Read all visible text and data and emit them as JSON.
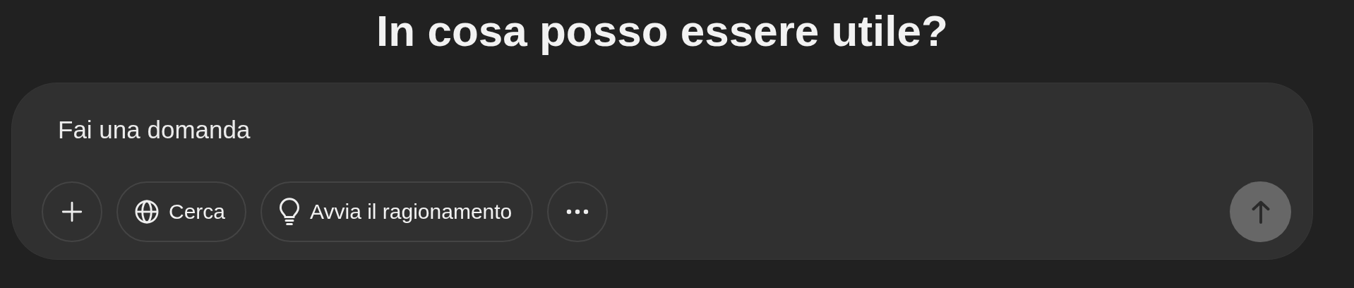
{
  "heading": "In cosa posso essere utile?",
  "composer": {
    "placeholder": "Fai una domanda",
    "tools": [
      {
        "kind": "plus"
      },
      {
        "kind": "globe",
        "label": "Cerca"
      },
      {
        "kind": "bulb",
        "label": "Avvia il ragionamento"
      },
      {
        "kind": "more"
      }
    ],
    "send": {
      "disabled": true
    }
  }
}
